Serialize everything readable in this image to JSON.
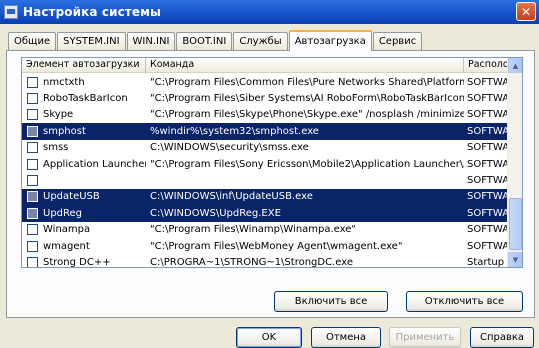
{
  "window": {
    "title": "Настройка системы",
    "close_glyph": "✕"
  },
  "tabs": [
    {
      "label": "Общие"
    },
    {
      "label": "SYSTEM.INI"
    },
    {
      "label": "WIN.INI"
    },
    {
      "label": "BOOT.INI"
    },
    {
      "label": "Службы"
    },
    {
      "label": "Автозагрузка"
    },
    {
      "label": "Сервис"
    }
  ],
  "active_tab": "Автозагрузка",
  "list": {
    "columns": [
      "Элемент автозагрузки",
      "Команда",
      "Располо"
    ],
    "rows": [
      {
        "name": "nmctxth",
        "command": "\"C:\\Program Files\\Common Files\\Pure Networks Shared\\Platform\\...",
        "location": "SOFTWA",
        "checked": false,
        "selected": false
      },
      {
        "name": "RoboTaskBarIcon",
        "command": "\"C:\\Program Files\\Siber Systems\\AI RoboForm\\RoboTaskBarIcon....",
        "location": "SOFTWA",
        "checked": false,
        "selected": false
      },
      {
        "name": "Skype",
        "command": "\"C:\\Program Files\\Skype\\Phone\\Skype.exe\" /nosplash /minimized",
        "location": "SOFTWA",
        "checked": false,
        "selected": false
      },
      {
        "name": "smphost",
        "command": "%windir%\\system32\\smphost.exe",
        "location": "SOFTWA",
        "checked": false,
        "selected": true
      },
      {
        "name": "smss",
        "command": "C:\\WINDOWS\\security\\smss.exe",
        "location": "SOFTWA",
        "checked": false,
        "selected": false
      },
      {
        "name": "Application Launcher",
        "command": "\"C:\\Program Files\\Sony Ericsson\\Mobile2\\Application Launcher\\Ap...",
        "location": "SOFTWA",
        "checked": false,
        "selected": false
      },
      {
        "name": "",
        "command": "",
        "location": "SOFTWA",
        "checked": false,
        "selected": false
      },
      {
        "name": "UpdateUSB",
        "command": "C:\\WINDOWS\\inf\\UpdateUSB.exe",
        "location": "SOFTWA",
        "checked": false,
        "selected": true
      },
      {
        "name": "UpdReg",
        "command": "C:\\WINDOWS\\UpdReg.EXE",
        "location": "SOFTWA",
        "checked": false,
        "selected": true
      },
      {
        "name": "Winampa",
        "command": "\"C:\\Program Files\\Winamp\\Winampa.exe\"",
        "location": "SOFTWA",
        "checked": false,
        "selected": false
      },
      {
        "name": "wmagent",
        "command": "\"C:\\Program Files\\WebMoney Agent\\wmagent.exe\"",
        "location": "SOFTWA",
        "checked": false,
        "selected": false
      },
      {
        "name": "Strong DC++",
        "command": "C:\\PROGRA~1\\STRONG~1\\StrongDC.exe",
        "location": "Startup",
        "checked": false,
        "selected": false
      }
    ]
  },
  "scrollbar": {
    "up_glyph": "▲",
    "down_glyph": "▼"
  },
  "buttons": {
    "enable_all": "Включить все",
    "disable_all": "Отключить все",
    "ok": "OK",
    "cancel": "Отмена",
    "apply": "Применить",
    "help": "Справка"
  }
}
